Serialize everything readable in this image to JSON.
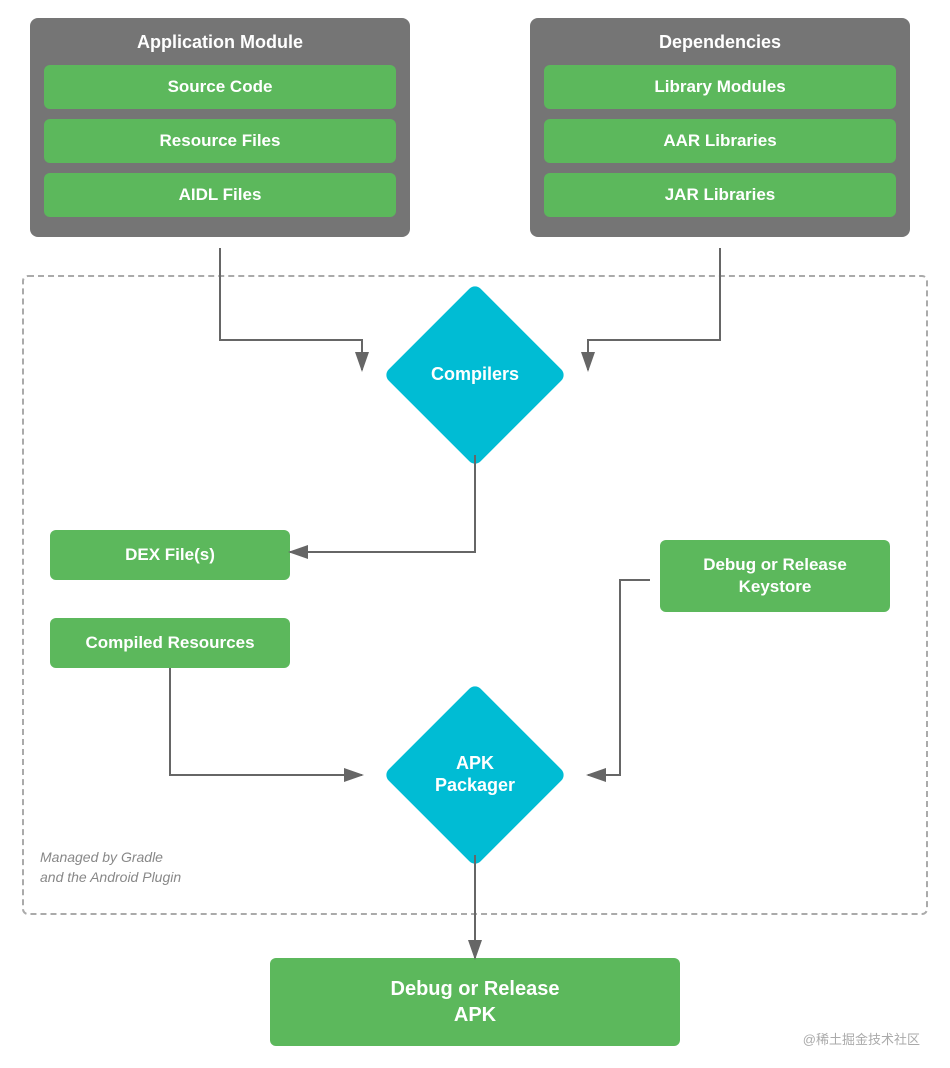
{
  "appModule": {
    "title": "Application Module",
    "items": [
      "Source Code",
      "Resource Files",
      "AIDL Files"
    ]
  },
  "dependencies": {
    "title": "Dependencies",
    "items": [
      "Library Modules",
      "AAR Libraries",
      "JAR Libraries"
    ]
  },
  "compilers": {
    "label": "Compilers"
  },
  "dexFiles": {
    "label": "DEX File(s)"
  },
  "compiledResources": {
    "label": "Compiled Resources"
  },
  "debugKeystore": {
    "label": "Debug or Release\nKeystore"
  },
  "apkPackager": {
    "label": "APK\nPackager"
  },
  "finalApk": {
    "label": "Debug or Release\nAPK"
  },
  "managedBy": {
    "line1": "Managed by Gradle",
    "line2": "and the Android Plugin"
  },
  "watermark": "@稀土掘金技术社区"
}
